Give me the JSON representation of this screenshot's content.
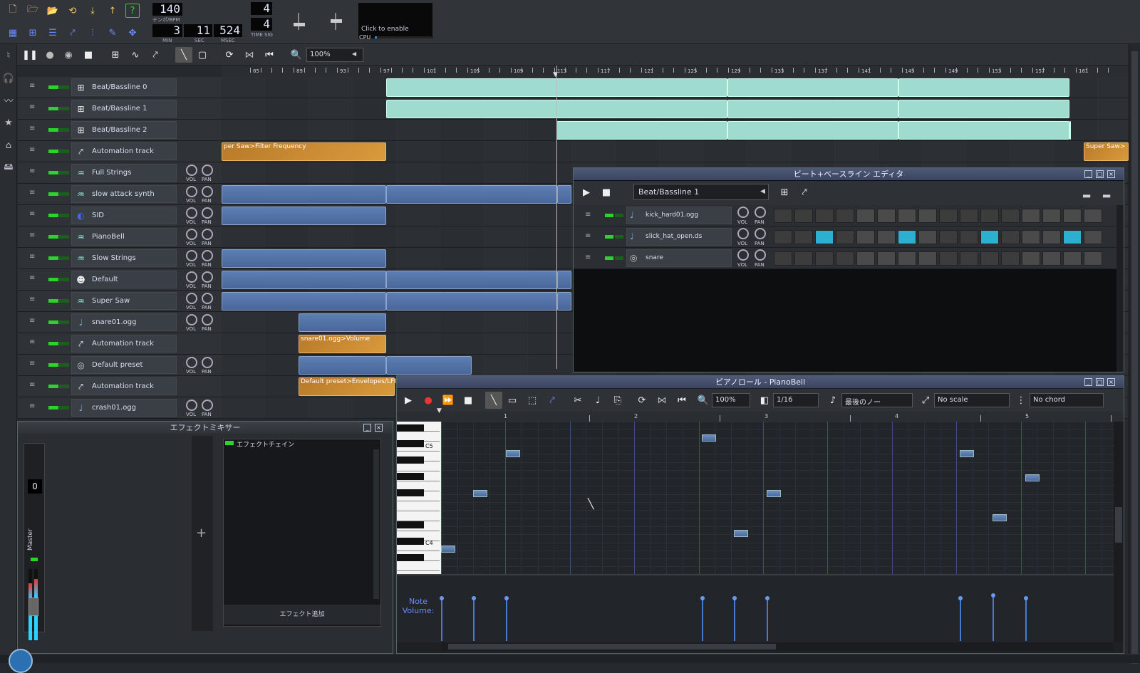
{
  "top": {
    "tempo": "140",
    "tempo_label": "テンポ/BPM",
    "min": "3",
    "min_label": "MIN",
    "sec": "11",
    "sec_label": "SEC",
    "msec": "524",
    "msec_label": "MSEC",
    "ts_num": "4",
    "ts_den": "4",
    "ts_label": "TIME SIG",
    "cpu_text": "Click to enable",
    "cpu_label": "CPU"
  },
  "song": {
    "zoom": "100%",
    "ruler": [
      "85",
      "89",
      "93",
      "97",
      "101",
      "105",
      "109",
      "113",
      "117",
      "121",
      "125",
      "129",
      "133",
      "137",
      "141",
      "145",
      "149",
      "153",
      "157",
      "161"
    ],
    "tracks": [
      {
        "name": "Beat/Bassline 0",
        "icon": "beat-bassline-icon",
        "knobs": false
      },
      {
        "name": "Beat/Bassline 1",
        "icon": "beat-bassline-icon",
        "knobs": false
      },
      {
        "name": "Beat/Bassline 2",
        "icon": "beat-bassline-icon",
        "knobs": false
      },
      {
        "name": "Automation track",
        "icon": "automation-icon",
        "knobs": false
      },
      {
        "name": "Full Strings",
        "icon": "synth-icon",
        "knobs": true
      },
      {
        "name": "slow attack synth",
        "icon": "synth-icon",
        "knobs": true
      },
      {
        "name": "SID",
        "icon": "sid-icon",
        "knobs": true
      },
      {
        "name": "PianoBell",
        "icon": "synth-icon",
        "knobs": true
      },
      {
        "name": "Slow Strings",
        "icon": "synth-icon",
        "knobs": true
      },
      {
        "name": "Default",
        "icon": "default-icon",
        "knobs": true
      },
      {
        "name": "Super Saw",
        "icon": "synth-icon",
        "knobs": true
      },
      {
        "name": "snare01.ogg",
        "icon": "sample-icon",
        "knobs": true
      },
      {
        "name": "Automation track",
        "icon": "automation-icon",
        "knobs": false
      },
      {
        "name": "Default preset",
        "icon": "preset-icon",
        "knobs": true
      },
      {
        "name": "Automation track",
        "icon": "automation-icon",
        "knobs": false
      },
      {
        "name": "crash01.ogg",
        "icon": "sample-icon",
        "knobs": true
      }
    ],
    "vol": "VOL",
    "pan": "PAN",
    "clip_labels": {
      "a1": "per Saw>Filter Frequency",
      "a2": "Super Saw>",
      "a3": "snare01.ogg>Volume",
      "a4": "Default preset>Envelopes/LFO"
    }
  },
  "bb": {
    "title": "ビート+ベースライン エディタ",
    "select": "Beat/Bassline 1",
    "tracks": [
      {
        "name": "kick_hard01.ogg",
        "icon": "sample-icon",
        "on": []
      },
      {
        "name": "slick_hat_open.ds",
        "icon": "sample-icon",
        "on": [
          2,
          6,
          10,
          14
        ]
      },
      {
        "name": "snare",
        "icon": "preset-icon",
        "on": []
      }
    ],
    "vol": "VOL",
    "pan": "PAN"
  },
  "piano": {
    "title": "ピアノロール - PianoBell",
    "zoom": "100%",
    "quant": "1/16",
    "note_len": "最後のノー",
    "scale": "No scale",
    "chord": "No chord",
    "key_c5": "C5",
    "key_c4": "C4",
    "note_vol": "Note\nVolume:",
    "ruler": [
      "1",
      "2",
      "3",
      "4",
      "5"
    ]
  },
  "mixer": {
    "title": "エフェクトミキサー",
    "chain": "エフェクトチェイン",
    "add": "エフェクト追加",
    "master": "Master",
    "num": "0"
  }
}
